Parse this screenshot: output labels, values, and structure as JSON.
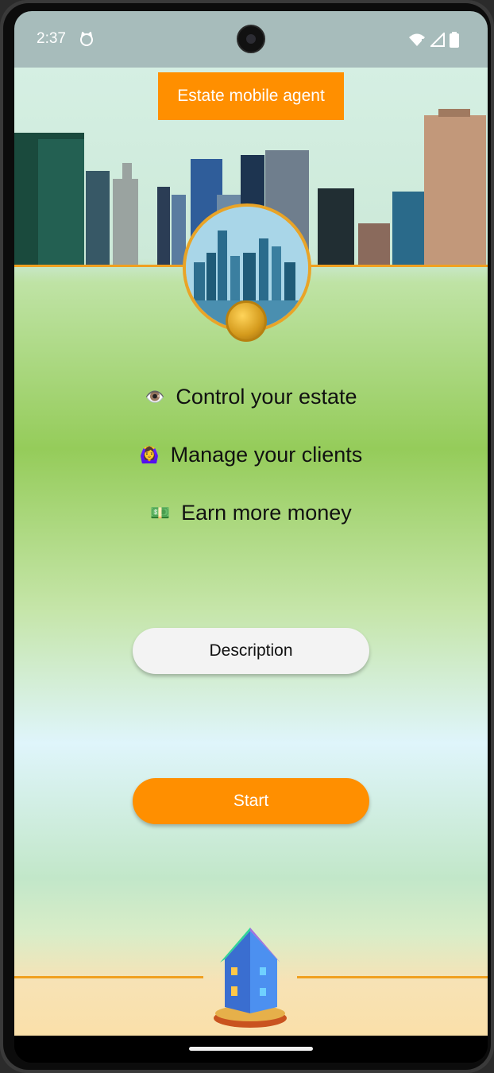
{
  "status_bar": {
    "time": "2:37",
    "icons": [
      "cat-face-icon",
      "wifi-icon",
      "signal-icon",
      "battery-icon"
    ]
  },
  "app": {
    "title": "Estate mobile agent",
    "features": [
      {
        "icon": "👁️",
        "icon_name": "eye-icon",
        "label": "Control your estate"
      },
      {
        "icon": "🙆‍♀️",
        "icon_name": "woman-gesture-icon",
        "label": "Manage your clients"
      },
      {
        "icon": "💵",
        "icon_name": "money-icon",
        "label": "Earn more money"
      }
    ],
    "description_button": "Description",
    "start_button": "Start"
  },
  "colors": {
    "accent": "#ff8f00",
    "status_bar": "#a7bcbb",
    "button_light": "#f3f3f3"
  }
}
